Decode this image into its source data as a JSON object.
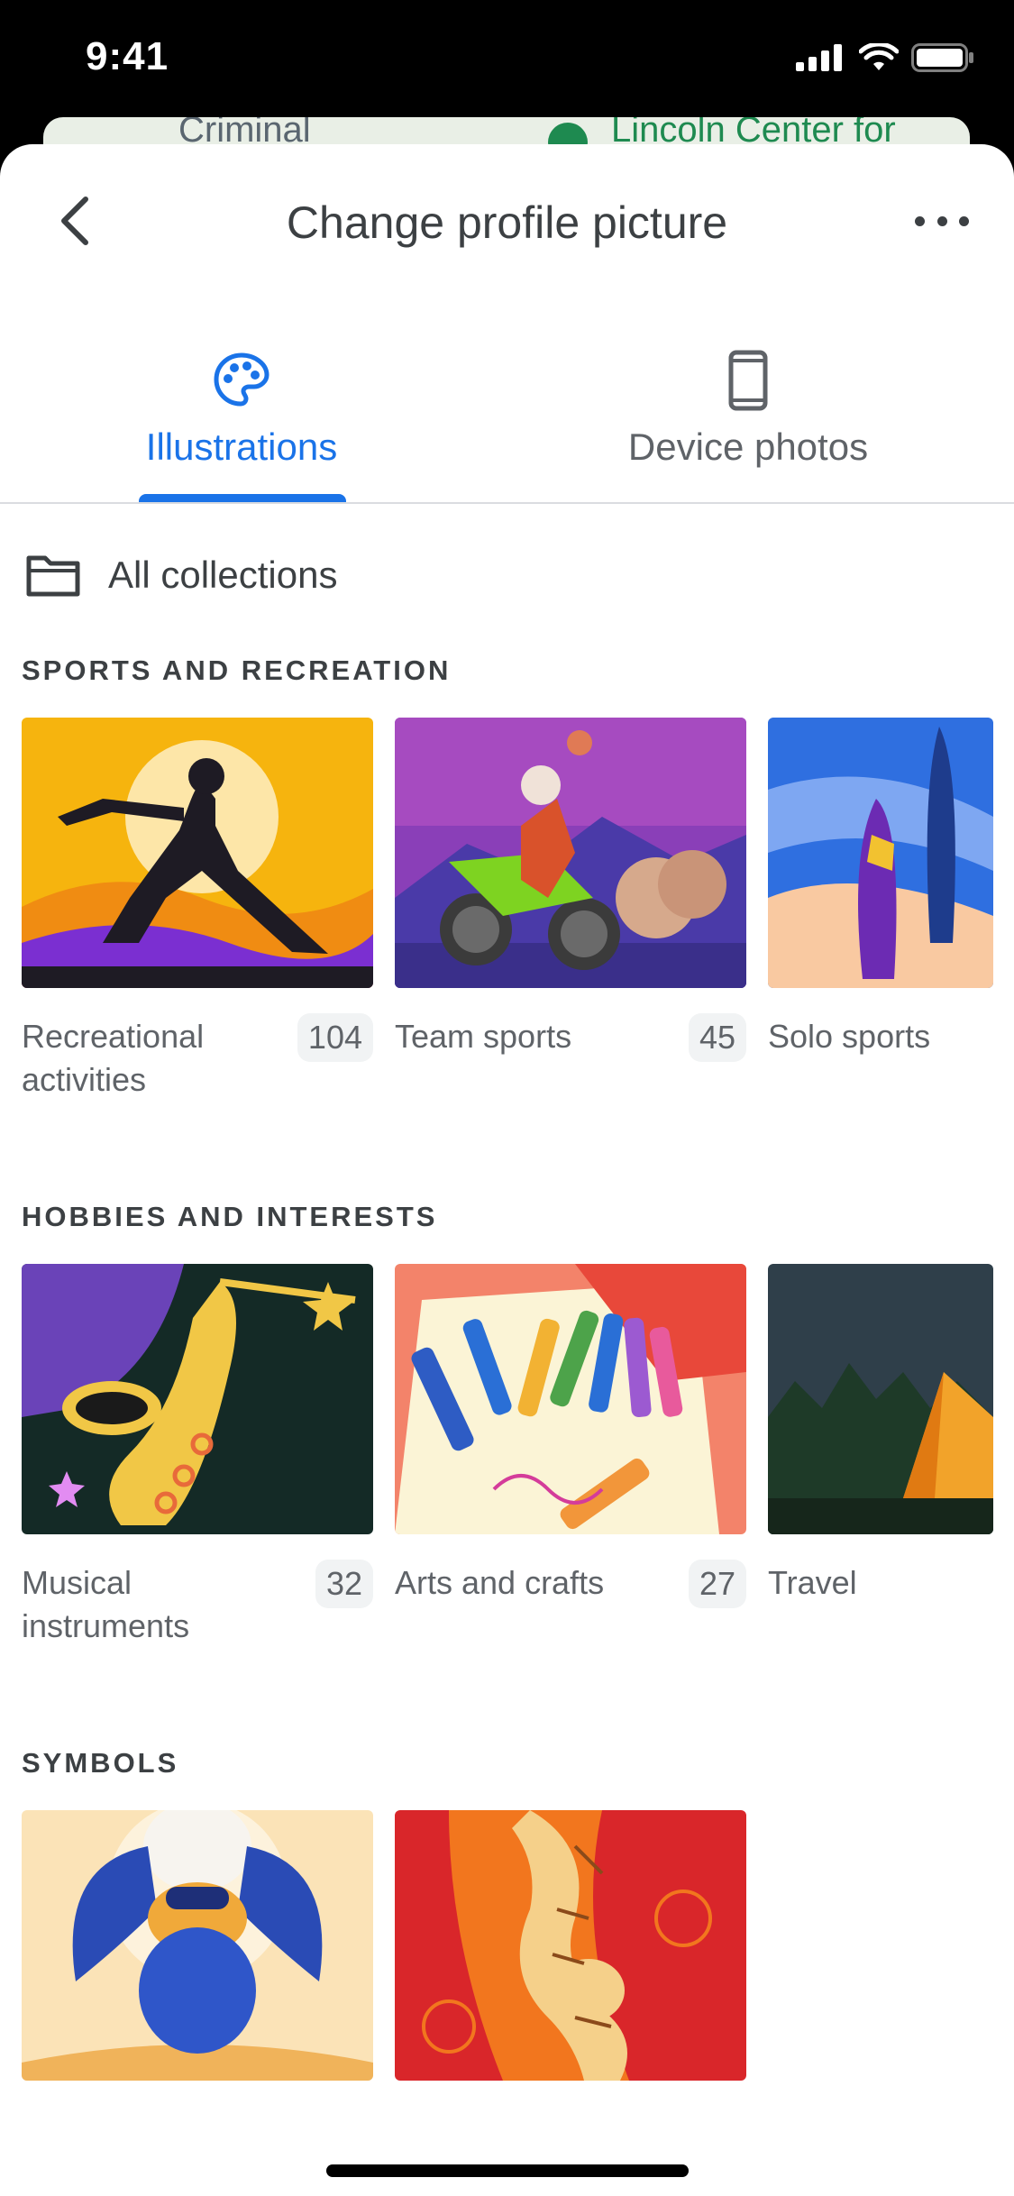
{
  "status_bar": {
    "time": "9:41"
  },
  "map_background": {
    "label_left": "Criminal",
    "label_right": "Lincoln Center for"
  },
  "header": {
    "title": "Change profile picture"
  },
  "tabs": [
    {
      "label": "Illustrations",
      "icon": "palette-icon",
      "active": true
    },
    {
      "label": "Device photos",
      "icon": "phone-icon",
      "active": false
    }
  ],
  "all_collections": {
    "label": "All collections",
    "icon": "folder-icon"
  },
  "sections": [
    {
      "title": "SPORTS AND RECREATION",
      "items": [
        {
          "name": "Recreational activities",
          "count": "104"
        },
        {
          "name": "Team sports",
          "count": "45"
        },
        {
          "name": "Solo sports",
          "count": ""
        }
      ]
    },
    {
      "title": "HOBBIES AND INTERESTS",
      "items": [
        {
          "name": "Musical instruments",
          "count": "32"
        },
        {
          "name": "Arts and crafts",
          "count": "27"
        },
        {
          "name": "Travel",
          "count": ""
        }
      ]
    },
    {
      "title": "SYMBOLS",
      "items": [
        {
          "name": "",
          "count": ""
        },
        {
          "name": "",
          "count": ""
        }
      ]
    }
  ],
  "colors": {
    "accent": "#1a73e8",
    "text": "#3c4043",
    "muted": "#5f6368"
  }
}
